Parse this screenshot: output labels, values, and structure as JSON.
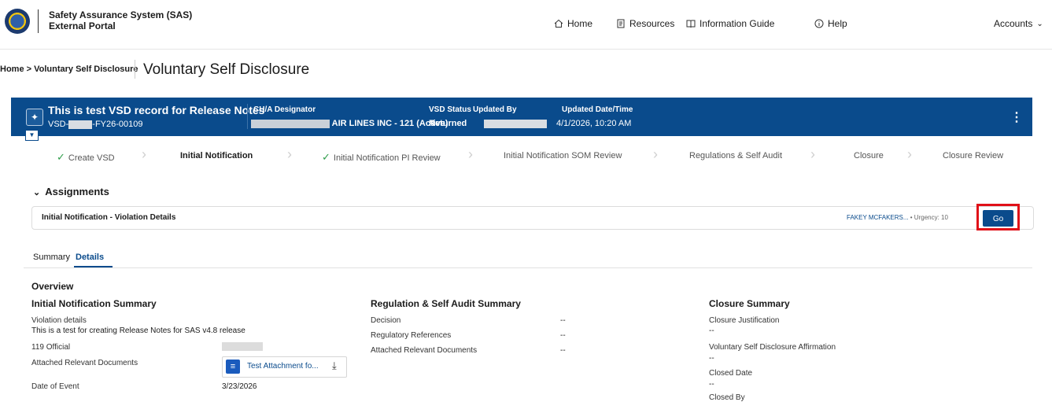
{
  "header": {
    "app_title_line1": "Safety Assurance System (SAS)",
    "app_title_line2": "External Portal",
    "nav": {
      "home": "Home",
      "resources": "Resources",
      "info_guide": "Information Guide",
      "help": "Help",
      "accounts": "Accounts"
    }
  },
  "breadcrumb": "Home > Voluntary Self Disclosure",
  "page_title": "Voluntary Self Disclosure",
  "banner": {
    "title": "This is test VSD record for Release Notes",
    "record_prefix": "VSD-",
    "record_suffix": "-FY26-00109",
    "designator_label": "CH/A Designator",
    "designator_value": "AIR LINES INC - 121 (Active)",
    "status_label": "VSD Status",
    "status_value": "Returned",
    "updated_by_label": "Updated By",
    "updated_dt_label": "Updated Date/Time",
    "updated_dt_value": "4/1/2026, 10:20 AM"
  },
  "steps": [
    {
      "label": "Create VSD"
    },
    {
      "label": "Initial Notification"
    },
    {
      "label": "Initial Notification PI Review"
    },
    {
      "label": "Initial Notification SOM Review"
    },
    {
      "label": "Regulations & Self Audit"
    },
    {
      "label": "Closure"
    },
    {
      "label": "Closure Review"
    }
  ],
  "assignments": {
    "heading": "Assignments",
    "item_title": "Initial Notification - Violation Details",
    "assignee": "FAKEY MCFAKERS...",
    "urgency": "• Urgency: 10",
    "go_label": "Go"
  },
  "tabs": {
    "summary": "Summary",
    "details": "Details"
  },
  "overview": {
    "heading": "Overview",
    "initial": {
      "heading": "Initial Notification Summary",
      "violation_label": "Violation details",
      "violation_value": "This is a test for creating Release Notes for SAS v4.8 release",
      "official_label": "119 Official",
      "attached_label": "Attached Relevant Documents",
      "attachment_name": "Test Attachment fo...",
      "date_label": "Date of Event",
      "date_value": "3/23/2026"
    },
    "regulation": {
      "heading": "Regulation & Self Audit Summary",
      "decision_label": "Decision",
      "decision_value": "--",
      "refs_label": "Regulatory References",
      "refs_value": "--",
      "attached_label": "Attached Relevant Documents",
      "attached_value": "--"
    },
    "closure": {
      "heading": "Closure Summary",
      "justification_label": "Closure Justification",
      "justification_value": "--",
      "affirmation_label": "Voluntary Self Disclosure Affirmation",
      "affirmation_value": "--",
      "closed_date_label": "Closed Date",
      "closed_date_value": "--",
      "closed_by_label": "Closed By"
    }
  },
  "colors": {
    "brand": "#0a4b8c",
    "check": "#2e9d4a",
    "highlight": "#e01018"
  }
}
